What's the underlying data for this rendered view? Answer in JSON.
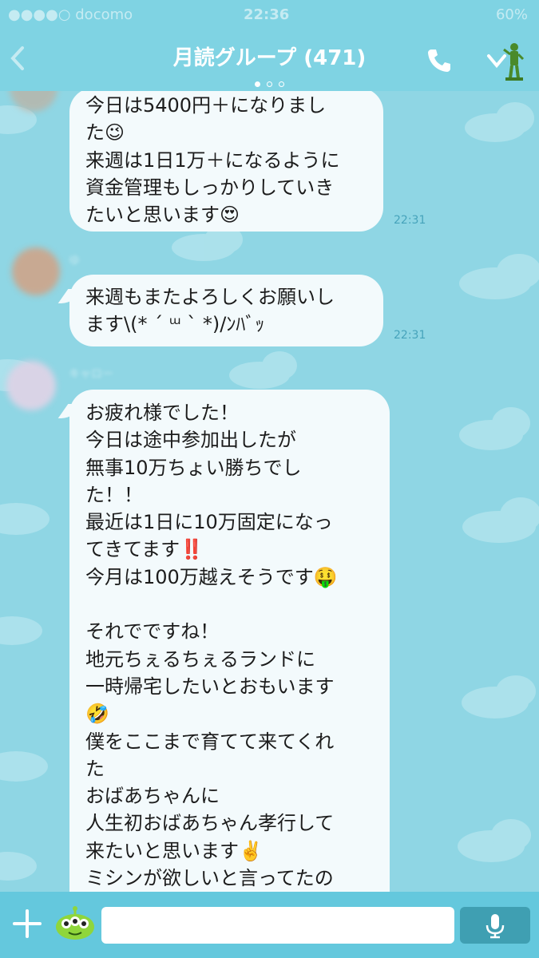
{
  "statusbar": {
    "carrier": "●●●●○ docomo",
    "time": "22:36",
    "battery": "60%"
  },
  "header": {
    "title": "月読グループ (471)",
    "page_count": 3,
    "active_page": 0
  },
  "messages": [
    {
      "text": "今日は5400円＋になりまし\nた😉\n来週は1日1万＋になるように\n資金管理もしっかりしていき\nたいと思います😍",
      "time": "22:31"
    },
    {
      "sender": "ゆ",
      "text": "来週もまたよろしくお願いし\nます\\(* ´ ᵚ ` *)/ﾝﾊﾞｯ",
      "time": "22:31"
    },
    {
      "sender": "キャロー",
      "text": "お疲れ様でした！\n今日は途中参加出したが\n無事10万ちょい勝ちでし\nた！！\n最近は1日に10万固定になっ\nてきてます‼️\n今月は100万越えそうです🤑\n\nそれでですね！\n地元ちぇるちぇるランドに\n一時帰宅したいとおもいます\n🤣\n僕をここまで育てて来てくれ\nた\nおばあちゃんに\n人生初おばあちゃん孝行して\n来たいと思います✌️\nミシンが欲しいと言ってたの"
    }
  ],
  "input": {
    "value": "",
    "placeholder": ""
  },
  "colors": {
    "header": "#7fd3e3",
    "background": "#8fd6e4",
    "bubble": "#f3fafc",
    "bottombar": "#64c8dd",
    "mic": "#3f9fb2"
  },
  "icons": {
    "back": "chevron-left-icon",
    "call": "phone-icon",
    "menu": "chevron-down-icon",
    "header_character": "army-man-icon",
    "add": "plus-icon",
    "sticker": "alien-sticker-icon",
    "mic": "microphone-icon"
  }
}
